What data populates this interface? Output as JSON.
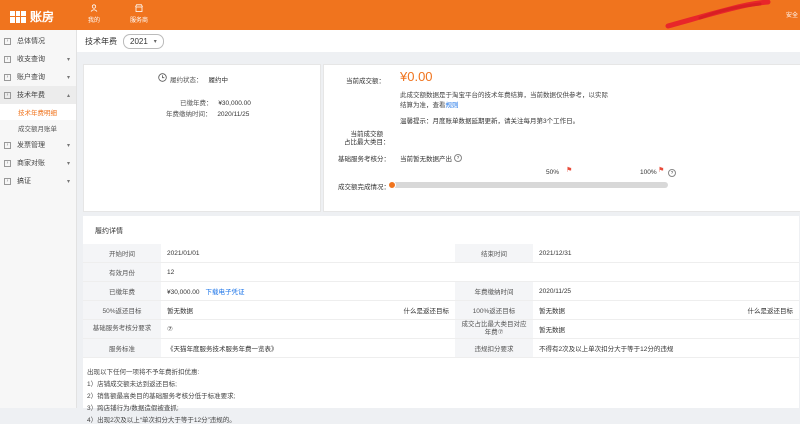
{
  "header": {
    "logo_text": "账房",
    "nav": [
      {
        "label": "我的",
        "icon": "user-icon"
      },
      {
        "label": "服务商",
        "icon": "store-icon"
      }
    ],
    "right_text": "安全"
  },
  "sidebar": {
    "items": [
      {
        "label": "总体情况",
        "arrow": ""
      },
      {
        "label": "收支查询",
        "arrow": "▾"
      },
      {
        "label": "账户查询",
        "arrow": "▾"
      },
      {
        "label": "技术年费",
        "arrow": "▴"
      },
      {
        "label": "发票管理",
        "arrow": "▾"
      },
      {
        "label": "商家对账",
        "arrow": "▾"
      },
      {
        "label": "搞证",
        "arrow": "▾"
      }
    ],
    "sub_items": [
      {
        "label": "技术年费明细"
      },
      {
        "label": "成交额月账单"
      }
    ]
  },
  "page": {
    "title": "技术年费",
    "year": "2021"
  },
  "status": {
    "status_label": "履约状态：",
    "status_value": "履约中",
    "paid_label": "已缴年费：",
    "paid_value": "¥30,000.00",
    "date_label": "年费缴纳时间：",
    "date_value": "2020/11/25"
  },
  "turnover": {
    "label": "当前成交额：",
    "amount": "¥0.00",
    "desc_line1": "此成交额数据是于淘宝平台的技术年费结算，当前数据仅供参考，以实际",
    "desc_line2_prefix": "结算为准，查看",
    "desc_line2_link": "规则",
    "note_label": "温馨提示：",
    "note_text": "月度账单数据延期更新，请关注每月第3个工作日。",
    "rank_label_line1": "当前成交额",
    "rank_label_line2": "占比最大类目：",
    "score_label": "基础服务考核分：",
    "score_value": "当前暂无数据产出",
    "progress_label": "成交额完成情况：",
    "progress": 0,
    "marker1_label": "50%",
    "marker2_label": "100%"
  },
  "detail": {
    "title": "履约详情",
    "rows": [
      {
        "k1": "开始时间",
        "v1": "2021/01/01",
        "a1": "",
        "k2": "结束时间",
        "v2": "2021/12/31",
        "a2": ""
      },
      {
        "k1": "有效月份",
        "v1": "12",
        "a1": "",
        "k2": "",
        "v2": "",
        "a2": ""
      },
      {
        "k1": "已缴年费",
        "v1": "¥30,000.00",
        "link1": "下载电子凭证",
        "a1": "",
        "k2": "年费缴纳时间",
        "v2": "2020/11/25",
        "a2": ""
      },
      {
        "k1": "50%返还目标",
        "v1": "暂无数据",
        "a1": "什么是返还目标",
        "k2": "100%返还目标",
        "v2": "暂无数据",
        "a2": "什么是返还目标"
      },
      {
        "k1": "基础服务考核分要求",
        "v1": "⑦",
        "a1": "",
        "k2": "成交占比最大类目对应年费⑦",
        "v2": "暂无数据",
        "a2": ""
      },
      {
        "k1": "服务标准",
        "v1": "《天猫年度服务技术服务年费一览表》",
        "a1": "",
        "k2": "违规扣分要求",
        "v2": "不得有2次及以上单次扣分大于等于12分的违规",
        "a2": ""
      }
    ]
  },
  "notes": {
    "intro": "出现以下任何一项将不予年费折扣优惠:",
    "items": [
      "1）店铺成交额未达到返还目标;",
      "2）销售额最高类目的基础服务考核分低于标准要求;",
      "3）跨店铺行为/数据造假被查抓;",
      "4）出现2次及以上“单次扣分大于等于12分”违规的。"
    ]
  },
  "colors": {
    "brand": "#f0741e",
    "link": "#1a73e8",
    "flag": "#e84b3a"
  }
}
